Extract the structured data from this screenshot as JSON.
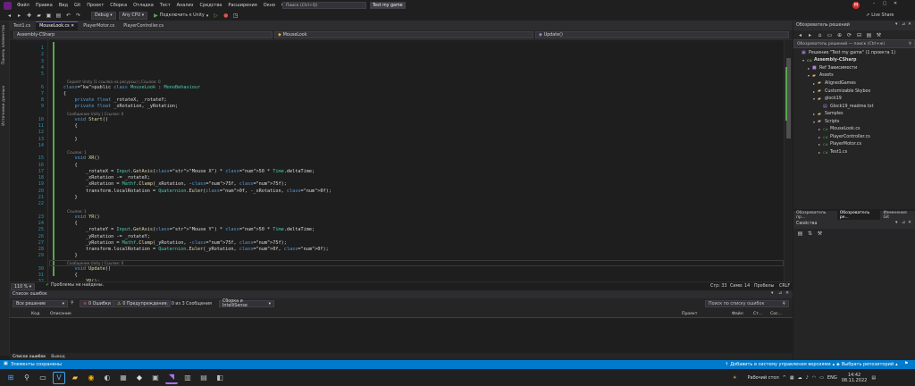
{
  "menu": {
    "items": [
      "Файл",
      "Правка",
      "Вид",
      "Git",
      "Проект",
      "Сборка",
      "Отладка",
      "Тест",
      "Анализ",
      "Средства",
      "Расширения",
      "Окно",
      "Справка"
    ],
    "search_placeholder": "Поиск (Ctrl+Q)",
    "solution_name": "Test my game",
    "avatar_letter": "M"
  },
  "toolbar": {
    "config": "Debug",
    "platform": "Any CPU",
    "attach_label": "Подключить к Unity",
    "live_share": "Live Share"
  },
  "left_rail": {
    "items": [
      "Панель элементов",
      "Источники данных"
    ]
  },
  "doc_tabs": [
    "Test1.cs",
    "MouseLook.cs",
    "PlayerMotor.cs",
    "PlayerController.cs"
  ],
  "navbar": {
    "project": "Assembly-CSharp",
    "class": "MouseLook",
    "member": "Update()"
  },
  "editor": {
    "lines": [
      {
        "n": "1",
        "text": ""
      },
      {
        "n": "2",
        "text": ""
      },
      {
        "n": "3",
        "text": ""
      },
      {
        "n": "4",
        "text": ""
      },
      {
        "n": "5",
        "text": ""
      },
      {
        "n": "6",
        "text": "public class MouseLook : MonoBehaviour"
      },
      {
        "n": "7",
        "text": "{"
      },
      {
        "n": "8",
        "text": "    private float _rotateX, _rotateY;"
      },
      {
        "n": "9",
        "text": "    private float _xRotation, _yRotation;"
      },
      {
        "n": "10",
        "text": "    void Start()"
      },
      {
        "n": "11",
        "text": "    {"
      },
      {
        "n": "12",
        "text": ""
      },
      {
        "n": "13",
        "text": "    }"
      },
      {
        "n": "14",
        "text": ""
      },
      {
        "n": "15",
        "text": "    void XR()"
      },
      {
        "n": "16",
        "text": "    {"
      },
      {
        "n": "17",
        "text": "        _rotateX = Input.GetAxis(\"Mouse X\") * 50 * Time.deltaTime;"
      },
      {
        "n": "18",
        "text": "        _xRotation -= _rotateX;"
      },
      {
        "n": "19",
        "text": "        _xRotation = Mathf.Clamp(_xRotation, -75f, 75f);"
      },
      {
        "n": "20",
        "text": "        transform.localRotation = Quaternion.Euler(0f, -_xRotation, 0f);"
      },
      {
        "n": "21",
        "text": "    }"
      },
      {
        "n": "22",
        "text": ""
      },
      {
        "n": "23",
        "text": "    void YR()"
      },
      {
        "n": "24",
        "text": "    {"
      },
      {
        "n": "25",
        "text": "        _rotateY = Input.GetAxis(\"Mouse Y\") * 50 * Time.deltaTime;"
      },
      {
        "n": "26",
        "text": "        _yRotation -= _rotateY;"
      },
      {
        "n": "27",
        "text": "        _yRotation = Mathf.Clamp(_yRotation, -75f, 75f);"
      },
      {
        "n": "28",
        "text": "        transform.localRotation = Quaternion.Euler(_yRotation, 0f, 0f);"
      },
      {
        "n": "29",
        "text": "    }"
      },
      {
        "n": "30",
        "text": "    void Update()"
      },
      {
        "n": "31",
        "text": "    {"
      },
      {
        "n": "32",
        "text": "        YR();"
      },
      {
        "n": "33",
        "text": "        XR();"
      },
      {
        "n": "34",
        "text": "    }"
      },
      {
        "n": "35",
        "text": "}"
      }
    ],
    "codelens": [
      {
        "line": "6",
        "text": "Скрипт Unity (1 ссылка на ресурсы) | Ссылок: 0"
      },
      {
        "line": "10",
        "text": "Сообщение Unity | Ссылок: 0"
      },
      {
        "line": "15",
        "text": "Ссылок: 1"
      },
      {
        "line": "23",
        "text": "Ссылок: 1"
      },
      {
        "line": "30",
        "text": "Сообщение Unity | Ссылок: 0"
      }
    ]
  },
  "editor_status": {
    "zoom": "110 %",
    "issues": "Проблемы не найдены.",
    "line": "Стр: 33",
    "col": "Симв: 14",
    "spaces": "Пробелы",
    "eol": "CRLF"
  },
  "error_list": {
    "title": "Список ошибок",
    "scope": "Все решение",
    "errors": "0 Ошибки",
    "warnings": "0 Предупреждения",
    "messages": "0 из 3 Сообщения",
    "filter": "Сборка и IntelliSense",
    "search_placeholder": "Поиск по списку ошибок",
    "columns": [
      "Код",
      "Описание",
      "Проект",
      "Файл",
      "Ст...",
      "Сос..."
    ]
  },
  "bottom_tabs": [
    "Список ошибок",
    "Вывод"
  ],
  "solution_explorer": {
    "title": "Обозреватель решений",
    "search": "Обозреватель решений — поиск (Ctrl+ж)",
    "tree": [
      {
        "depth": 0,
        "arrow": "",
        "icon": "▣",
        "label": "Решение \"Test my game\" (1 проекта 1)"
      },
      {
        "depth": 1,
        "arrow": "▾",
        "icon": "C#",
        "label": "Assembly-CSharp"
      },
      {
        "depth": 2,
        "arrow": "▸",
        "icon": "■",
        "label": "Ref Зависимости"
      },
      {
        "depth": 2,
        "arrow": "▾",
        "icon": "▰",
        "label": "Assets"
      },
      {
        "depth": 3,
        "arrow": "▸",
        "icon": "▰",
        "label": "AlignedGames"
      },
      {
        "depth": 3,
        "arrow": "▸",
        "icon": "▰",
        "label": "Customizable Skybox"
      },
      {
        "depth": 3,
        "arrow": "▾",
        "icon": "▰",
        "label": "glock19"
      },
      {
        "depth": 4,
        "arrow": "",
        "icon": "▤",
        "label": "Glock19_readme.txt"
      },
      {
        "depth": 3,
        "arrow": "▸",
        "icon": "▰",
        "label": "Samples"
      },
      {
        "depth": 3,
        "arrow": "▾",
        "icon": "▰",
        "label": "Scripts"
      },
      {
        "depth": 4,
        "arrow": "▸",
        "icon": "C#",
        "label": "MouseLook.cs"
      },
      {
        "depth": 4,
        "arrow": "▸",
        "icon": "C#",
        "label": "PlayerController.cs"
      },
      {
        "depth": 4,
        "arrow": "▸",
        "icon": "C#",
        "label": "PlayerMotor.cs"
      },
      {
        "depth": 4,
        "arrow": "▸",
        "icon": "C#",
        "label": "Test1.cs"
      }
    ],
    "tabs": [
      "Обозреватель пр...",
      "Обозреватель ре...",
      "Изменения Git"
    ]
  },
  "properties": {
    "title": "Свойства"
  },
  "status_bar": {
    "left": "Элементы сохранены",
    "scm": "Добавить в систему управления версиями",
    "repo": "Выбрать репозиторий"
  },
  "taskbar": {
    "desktop": "Рабочий стол",
    "lang": "ENG",
    "time": "14:42",
    "date": "08.11.2022"
  },
  "colors": {
    "accent": "#007acc",
    "vs_purple": "#68217a",
    "keyword": "#569cd6",
    "type": "#4ec9b0",
    "string": "#d69d85"
  }
}
